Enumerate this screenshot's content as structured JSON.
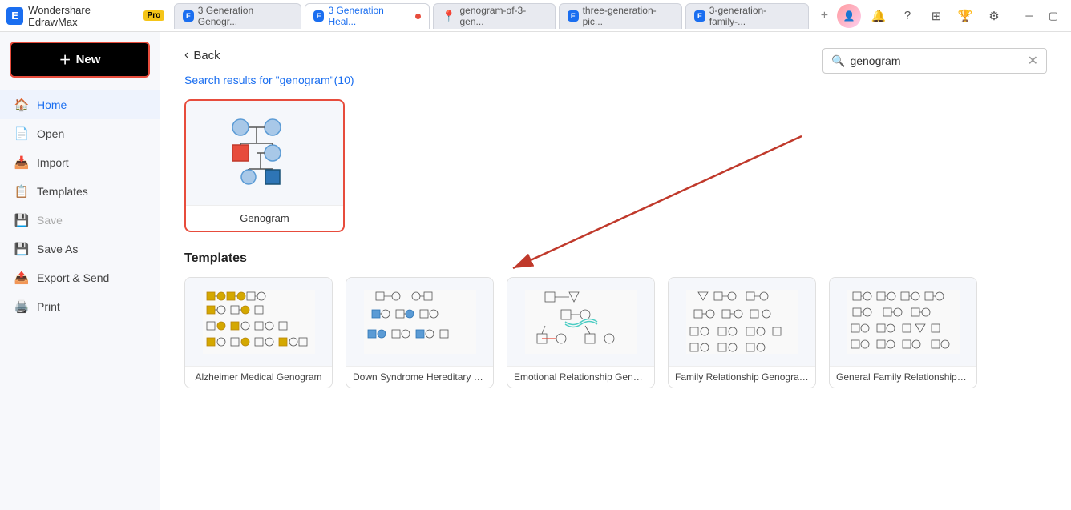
{
  "app": {
    "name": "Wondershare EdrawMax",
    "pro_label": "Pro"
  },
  "titlebar": {
    "tabs": [
      {
        "id": "tab1",
        "label": "3 Generation Genogr...",
        "active": false,
        "dot": false
      },
      {
        "id": "tab2",
        "label": "3 Generation Heal...",
        "active": true,
        "dot": true
      },
      {
        "id": "tab3",
        "label": "genogram-of-3-gen...",
        "active": false,
        "dot": false
      },
      {
        "id": "tab4",
        "label": "three-generation-pic...",
        "active": false,
        "dot": false
      },
      {
        "id": "tab5",
        "label": "3-generation-family-...",
        "active": false,
        "dot": false
      }
    ],
    "new_tab_title": "+"
  },
  "sidebar": {
    "new_label": "New",
    "items": [
      {
        "id": "home",
        "label": "Home",
        "active": true,
        "icon": "🏠"
      },
      {
        "id": "open",
        "label": "Open",
        "active": false,
        "icon": "📄"
      },
      {
        "id": "import",
        "label": "Import",
        "active": false,
        "icon": "📥"
      },
      {
        "id": "templates",
        "label": "Templates",
        "active": false,
        "icon": "📋"
      },
      {
        "id": "save",
        "label": "Save",
        "active": false,
        "disabled": true,
        "icon": "💾"
      },
      {
        "id": "saveas",
        "label": "Save As",
        "active": false,
        "icon": "💾"
      },
      {
        "id": "export",
        "label": "Export & Send",
        "active": false,
        "icon": "📤"
      },
      {
        "id": "print",
        "label": "Print",
        "active": false,
        "icon": "🖨️"
      }
    ]
  },
  "content": {
    "back_label": "Back",
    "search_results_prefix": "Search results for ",
    "search_term": "genogram",
    "search_count": "(10)",
    "search_placeholder": "genogram",
    "top_card": {
      "label": "Genogram"
    },
    "templates_section_title": "Templates",
    "template_cards": [
      {
        "id": "alzheimer",
        "label": "Alzheimer Medical Genogram"
      },
      {
        "id": "down_syndrome",
        "label": "Down Syndrome Hereditary Me..."
      },
      {
        "id": "emotional",
        "label": "Emotional Relationship Genogram"
      },
      {
        "id": "family_rel",
        "label": "Family Relationship Genogram ..."
      },
      {
        "id": "general_family",
        "label": "General Family Relationships Ge..."
      }
    ]
  },
  "colors": {
    "accent": "#1a6ef0",
    "danger": "#e74c3c",
    "male_blue": "#5b9bd5",
    "female_pink": "#f4a9a8",
    "dark_blue": "#2e75b6"
  }
}
